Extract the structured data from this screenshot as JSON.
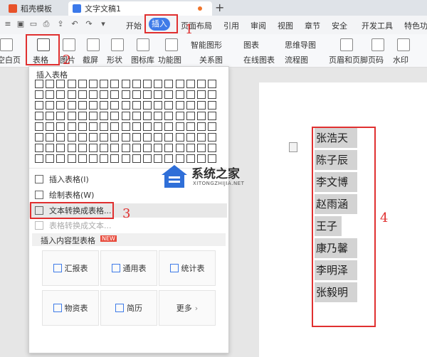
{
  "titlebar": {
    "tabs": [
      {
        "label": "稻壳模板"
      },
      {
        "label": "文字文稿1"
      }
    ],
    "new_tab": "+"
  },
  "menubar": {
    "items": [
      "开始",
      "插入",
      "页面布局",
      "引用",
      "审阅",
      "视图",
      "章节",
      "安全",
      "开发工具",
      "特色功能"
    ],
    "active": "插入"
  },
  "ribbon": {
    "items": [
      "空白页",
      "表格",
      "图片",
      "截屏",
      "形状",
      "图标库",
      "功能图",
      "智能图形",
      "图表",
      "思维导图",
      "关系图",
      "在线图表",
      "流程图",
      "页眉和页脚",
      "页码",
      "水印"
    ]
  },
  "dropdown": {
    "grid_title": "插入表格",
    "grid_rows": 8,
    "grid_cols": 17,
    "menu": [
      {
        "label": "插入表格(I)",
        "enabled": true
      },
      {
        "label": "绘制表格(W)",
        "enabled": true
      },
      {
        "label": "文本转换成表格...",
        "enabled": true,
        "highlight": true
      },
      {
        "label": "表格转换成文本...",
        "enabled": false
      }
    ],
    "content_tables_title": "插入内容型表格",
    "new_badge": "NEW",
    "cards": [
      "汇报表",
      "通用表",
      "统计表",
      "物资表",
      "简历",
      "更多"
    ]
  },
  "document": {
    "names": [
      "张浩天",
      "陈子辰",
      "李文博",
      "赵雨涵",
      "王子",
      "康乃馨",
      "李明泽",
      "张毅明"
    ]
  },
  "annotations": [
    "1",
    "2",
    "3",
    "4"
  ],
  "watermark": {
    "title": "系统之家",
    "url": "XITONGZHIJIA.NET"
  },
  "colors": {
    "accent": "#3f7be8",
    "annotation": "#e03030",
    "selection": "#d3d3d3"
  }
}
